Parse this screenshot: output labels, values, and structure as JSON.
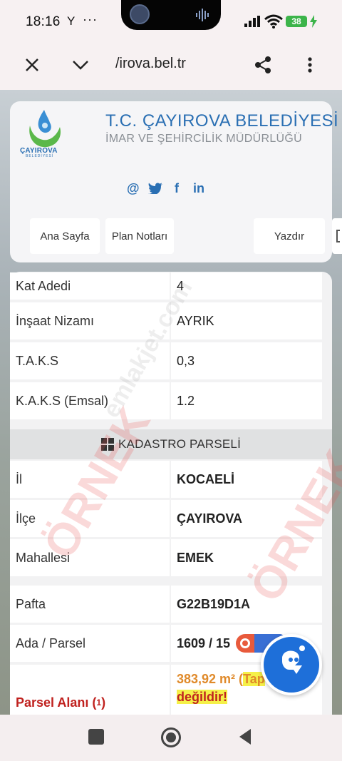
{
  "status": {
    "time": "18:16",
    "y": "Y",
    "dots": "···",
    "battery": "38"
  },
  "browser": {
    "url": "/irova.bel.tr"
  },
  "header": {
    "logo_text": "ÇAYIROVA",
    "logo_sub": "BELEDİYESİ",
    "title": "T.C. ÇAYIROVA BELEDİYESİ",
    "subtitle": "İMAR VE ŞEHİRCİLİK MÜDÜRLÜĞÜ",
    "social": [
      "@",
      "t",
      "f",
      "in"
    ],
    "nav": [
      "Ana Sayfa",
      "Plan Notları",
      "Yazdır"
    ]
  },
  "imar_rows": [
    {
      "label": "Kat Adedi",
      "value": "4"
    },
    {
      "label": "İnşaat Nizamı",
      "value": "AYRIK"
    },
    {
      "label": "T.A.K.S",
      "value": "0,3"
    },
    {
      "label": "K.A.K.S (Emsal)",
      "value": "1.2"
    }
  ],
  "section": {
    "title": "KADASTRO PARSELİ"
  },
  "kadastro_rows": [
    {
      "label": "İl",
      "value": "KOCAELİ"
    },
    {
      "label": "İlçe",
      "value": "ÇAYIROVA"
    },
    {
      "label": "Mahallesi",
      "value": "EMEK"
    },
    {
      "label": "Pafta",
      "value": "G22B19D1A"
    },
    {
      "label": "Ada / Parsel",
      "value": "1609 / 15"
    }
  ],
  "parcel_area": {
    "label": "Parsel Alanı (",
    "sup": "1",
    "label_end": ")",
    "value": "383,92 m² (",
    "highlight": "Tap",
    "line2": "değildir!"
  },
  "watermark": [
    "ÖRNEK",
    "emlakjet.com"
  ]
}
